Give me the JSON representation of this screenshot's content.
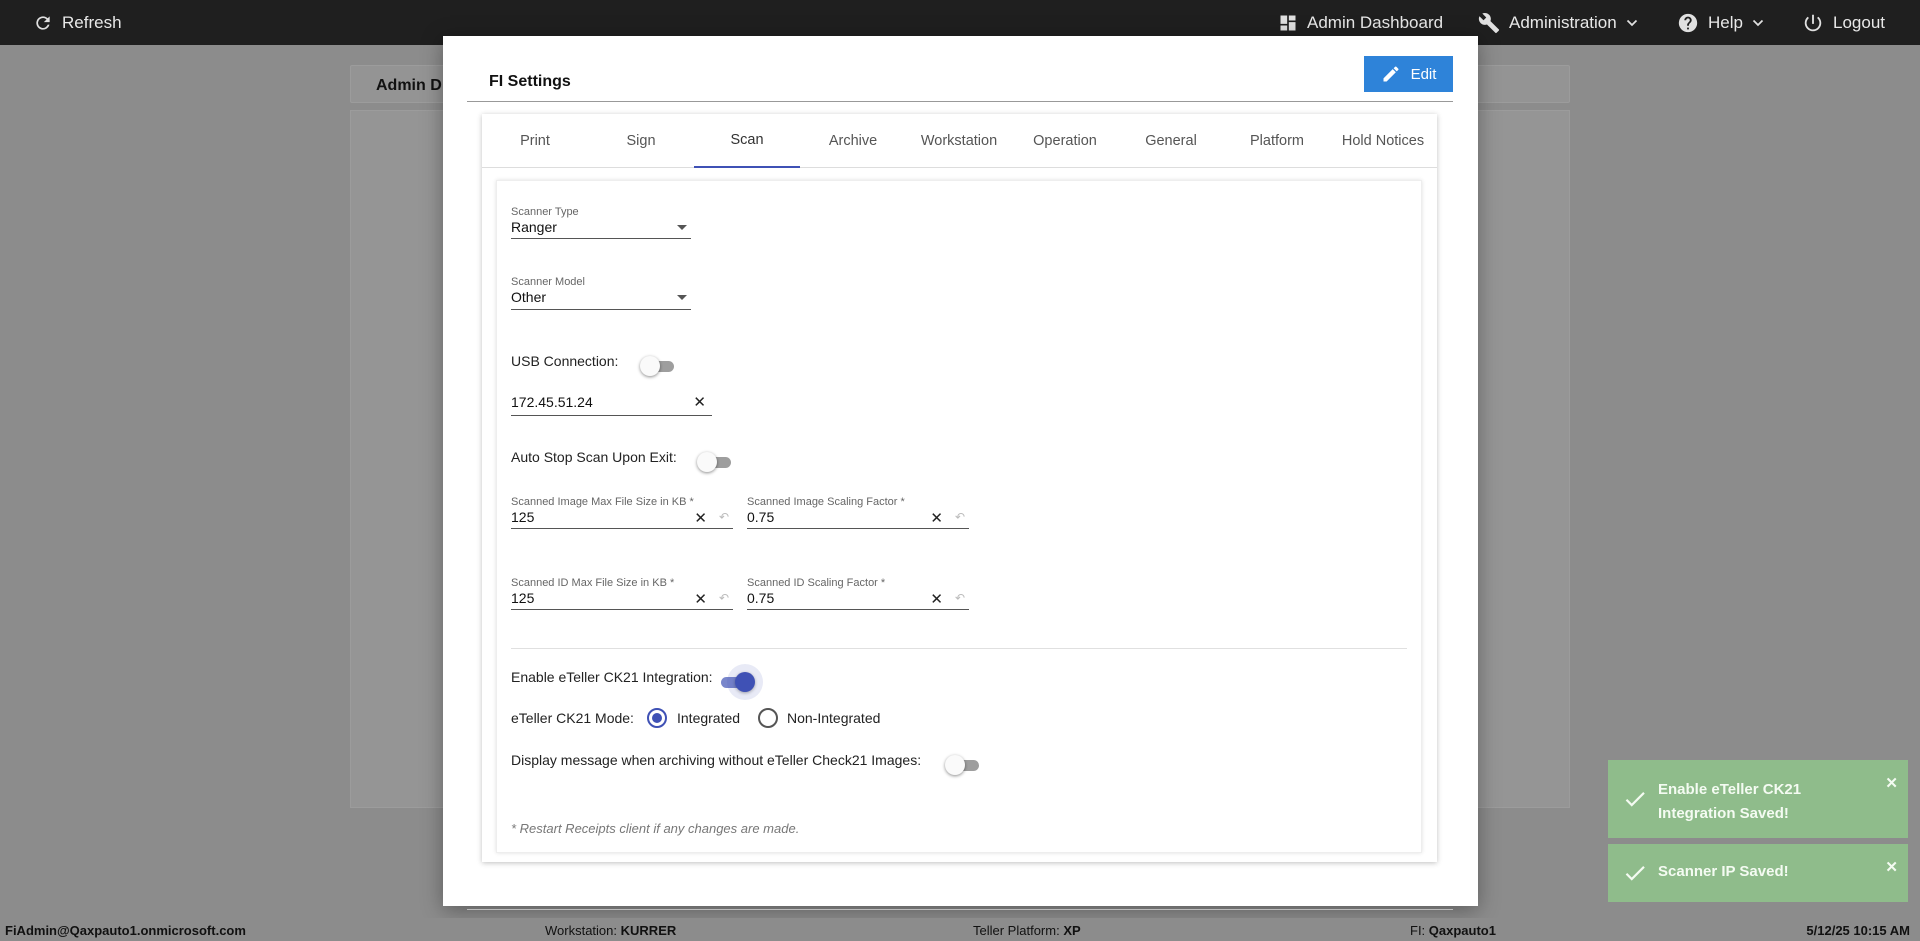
{
  "topbar": {
    "refresh": "Refresh",
    "admin_dashboard": "Admin Dashboard",
    "administration": "Administration",
    "help": "Help",
    "logout": "Logout"
  },
  "background": {
    "tab_label": "Admin D"
  },
  "modal": {
    "title": "FI Settings",
    "edit_label": "Edit",
    "tabs": [
      {
        "label": "Print"
      },
      {
        "label": "Sign"
      },
      {
        "label": "Scan"
      },
      {
        "label": "Archive"
      },
      {
        "label": "Workstation"
      },
      {
        "label": "Operation"
      },
      {
        "label": "General"
      },
      {
        "label": "Platform"
      },
      {
        "label": "Hold Notices"
      }
    ],
    "active_tab": "Scan"
  },
  "scan": {
    "scanner_type": {
      "label": "Scanner Type",
      "value": "Ranger"
    },
    "scanner_model": {
      "label": "Scanner Model",
      "value": "Other"
    },
    "usb_connection": {
      "label": "USB Connection:",
      "on": false
    },
    "scanner_ip": {
      "value": "172.45.51.24"
    },
    "auto_stop": {
      "label": "Auto Stop Scan Upon Exit:",
      "on": false
    },
    "image_max_size": {
      "label": "Scanned Image Max File Size in KB *",
      "value": "125"
    },
    "image_scaling": {
      "label": "Scanned Image Scaling Factor *",
      "value": "0.75"
    },
    "id_max_size": {
      "label": "Scanned ID Max File Size in KB *",
      "value": "125"
    },
    "id_scaling": {
      "label": "Scanned ID Scaling Factor *",
      "value": "0.75"
    },
    "ck21_enable": {
      "label": "Enable eTeller CK21 Integration:",
      "on": true
    },
    "ck21_mode": {
      "label": "eTeller CK21 Mode:",
      "options": [
        "Integrated",
        "Non-Integrated"
      ],
      "selected": "Integrated"
    },
    "display_message": {
      "label": "Display message when archiving without eTeller Check21 Images:",
      "on": false
    },
    "note": "* Restart Receipts client if any changes are made."
  },
  "toasts": [
    {
      "message": "Enable eTeller CK21 Integration Saved!"
    },
    {
      "message": "Scanner IP Saved!"
    }
  ],
  "statusbar": {
    "user": "FiAdmin@Qaxpauto1.onmicrosoft.com",
    "workstation_label": "Workstation:",
    "workstation_value": "KURRER",
    "platform_label": "Teller Platform:",
    "platform_value": "XP",
    "fi_label": "FI:",
    "fi_value": "Qaxpauto1",
    "datetime": "5/12/25 10:15 AM"
  },
  "colors": {
    "accent": "#3f51b5",
    "edit_button": "#2e83d9",
    "toast": "#8fbc8b",
    "topbar": "#1f1f1f"
  }
}
